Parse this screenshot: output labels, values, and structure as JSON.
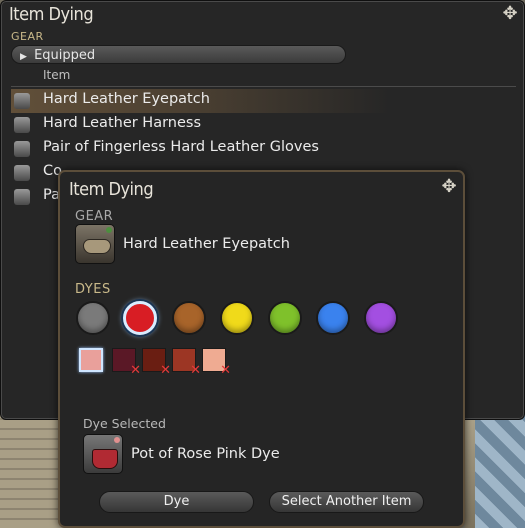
{
  "main_window": {
    "title": "Item Dying",
    "section_label": "GEAR",
    "filter_tab_label": "Equipped",
    "column_header": "Item",
    "items": [
      {
        "label": "Hard Leather Eyepatch",
        "selected": true,
        "icon": "eyepatch-icon"
      },
      {
        "label": "Hard Leather Harness",
        "selected": false,
        "icon": "body-armor-icon"
      },
      {
        "label": "Pair of Fingerless Hard Leather Gloves",
        "selected": false,
        "icon": "gloves-icon"
      },
      {
        "label": "Co",
        "selected": false,
        "icon": "legs-icon"
      },
      {
        "label": "Pa",
        "selected": false,
        "icon": "feet-icon"
      }
    ]
  },
  "dialog": {
    "title": "Item Dying",
    "gear_label": "GEAR",
    "gear_item": "Hard Leather Eyepatch",
    "dyes_label": "DYES",
    "dye_colors": [
      {
        "name": "gray",
        "color": "#7a7a7a",
        "selected": false
      },
      {
        "name": "red",
        "color": "#d81d24",
        "selected": true
      },
      {
        "name": "brown",
        "color": "#a8642a",
        "selected": false
      },
      {
        "name": "yellow",
        "color": "#f0da1a",
        "selected": false
      },
      {
        "name": "green",
        "color": "#7fc12b",
        "selected": false
      },
      {
        "name": "blue",
        "color": "#3a82ee",
        "selected": false
      },
      {
        "name": "purple",
        "color": "#a34fe1",
        "selected": false
      }
    ],
    "shades": [
      {
        "color": "#e9a09b",
        "selected": true,
        "unavailable": false
      },
      {
        "color": "#5a1826",
        "selected": false,
        "unavailable": true
      },
      {
        "color": "#6a1e12",
        "selected": false,
        "unavailable": true
      },
      {
        "color": "#9c3624",
        "selected": false,
        "unavailable": true
      },
      {
        "color": "#efab92",
        "selected": false,
        "unavailable": true
      }
    ],
    "dye_selected_label": "Dye Selected",
    "dye_selected_name": "Pot of Rose Pink Dye",
    "buttons": {
      "dye": "Dye",
      "select_another": "Select Another Item"
    },
    "x_glyph": "✕"
  },
  "colors": {
    "section_heading": "#c9b98a",
    "selection_highlight": "#aa8250",
    "dialog_border": "#5c4e3a"
  }
}
